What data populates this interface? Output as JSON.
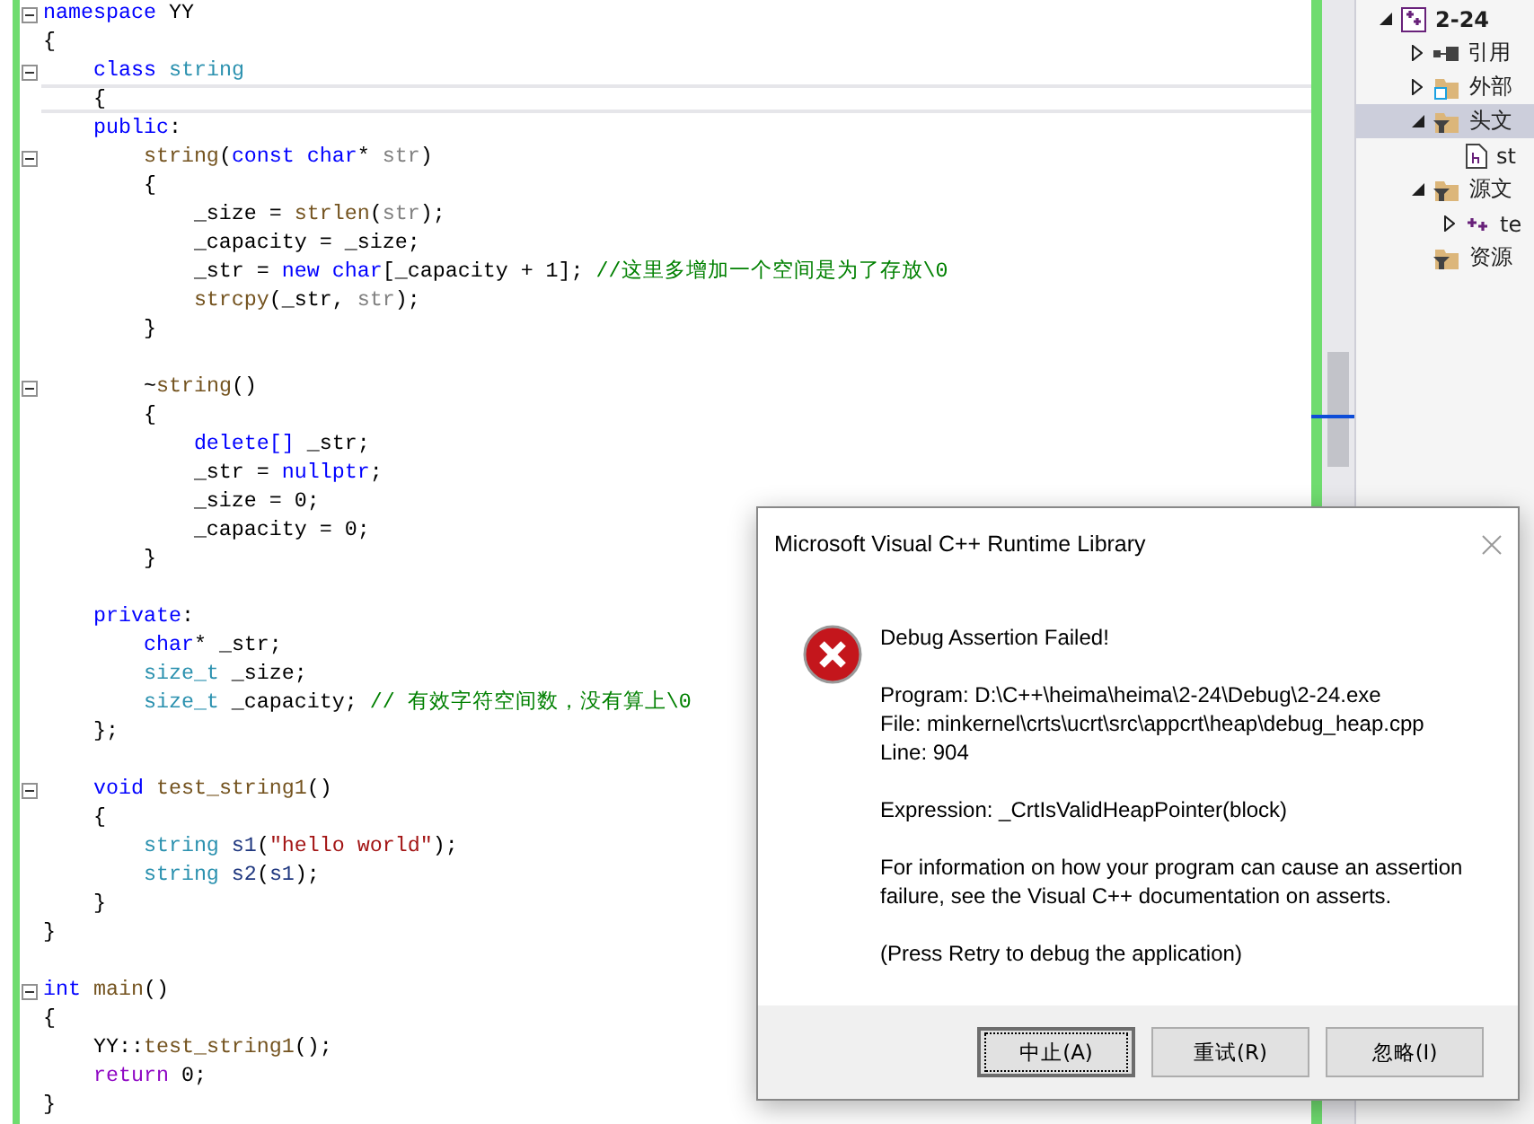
{
  "editor": {
    "lines": [
      {
        "fold": true,
        "current": false,
        "tokens": [
          {
            "kind": "kw",
            "text": "namespace"
          },
          {
            "kind": "plain",
            "text": " YY"
          }
        ]
      },
      {
        "fold": false,
        "current": false,
        "tokens": [
          {
            "kind": "plain",
            "text": "{"
          }
        ]
      },
      {
        "fold": true,
        "current": false,
        "tokens": [
          {
            "kind": "kw",
            "text": "    class"
          },
          {
            "kind": "type",
            "text": " string"
          }
        ]
      },
      {
        "fold": false,
        "current": true,
        "tokens": [
          {
            "kind": "plain",
            "text": "    {"
          }
        ]
      },
      {
        "fold": false,
        "current": false,
        "tokens": [
          {
            "kind": "kw",
            "text": "    public"
          },
          {
            "kind": "plain",
            "text": ":"
          }
        ]
      },
      {
        "fold": true,
        "current": false,
        "tokens": [
          {
            "kind": "fn",
            "text": "        string"
          },
          {
            "kind": "plain",
            "text": "("
          },
          {
            "kind": "kw",
            "text": "const char"
          },
          {
            "kind": "plain",
            "text": "* "
          },
          {
            "kind": "param",
            "text": "str"
          },
          {
            "kind": "plain",
            "text": ")"
          }
        ]
      },
      {
        "fold": false,
        "current": false,
        "tokens": [
          {
            "kind": "plain",
            "text": "        {"
          }
        ]
      },
      {
        "fold": false,
        "current": false,
        "tokens": [
          {
            "kind": "plain",
            "text": "            _size = "
          },
          {
            "kind": "fn",
            "text": "strlen"
          },
          {
            "kind": "plain",
            "text": "("
          },
          {
            "kind": "param",
            "text": "str"
          },
          {
            "kind": "plain",
            "text": ");"
          }
        ]
      },
      {
        "fold": false,
        "current": false,
        "tokens": [
          {
            "kind": "plain",
            "text": "            _capacity = _size;"
          }
        ]
      },
      {
        "fold": false,
        "current": false,
        "tokens": [
          {
            "kind": "plain",
            "text": "            _str = "
          },
          {
            "kind": "kw",
            "text": "new char"
          },
          {
            "kind": "plain",
            "text": "[_capacity + 1]; "
          },
          {
            "kind": "comment",
            "text": "//这里多增加一个空间是为了存放\\0"
          }
        ]
      },
      {
        "fold": false,
        "current": false,
        "tokens": [
          {
            "kind": "fn",
            "text": "            strcpy"
          },
          {
            "kind": "plain",
            "text": "(_str, "
          },
          {
            "kind": "param",
            "text": "str"
          },
          {
            "kind": "plain",
            "text": ");"
          }
        ]
      },
      {
        "fold": false,
        "current": false,
        "tokens": [
          {
            "kind": "plain",
            "text": "        }"
          }
        ]
      },
      {
        "fold": false,
        "current": false
      },
      {
        "fold": true,
        "current": false,
        "tokens": [
          {
            "kind": "plain",
            "text": "        ~"
          },
          {
            "kind": "fn",
            "text": "string"
          },
          {
            "kind": "plain",
            "text": "()"
          }
        ]
      },
      {
        "fold": false,
        "current": false,
        "tokens": [
          {
            "kind": "plain",
            "text": "        {"
          }
        ]
      },
      {
        "fold": false,
        "current": false,
        "tokens": [
          {
            "kind": "kw",
            "text": "            delete[]"
          },
          {
            "kind": "plain",
            "text": " _str;"
          }
        ]
      },
      {
        "fold": false,
        "current": false,
        "tokens": [
          {
            "kind": "plain",
            "text": "            _str = "
          },
          {
            "kind": "kw",
            "text": "nullptr"
          },
          {
            "kind": "plain",
            "text": ";"
          }
        ]
      },
      {
        "fold": false,
        "current": false,
        "tokens": [
          {
            "kind": "plain",
            "text": "            _size = 0;"
          }
        ]
      },
      {
        "fold": false,
        "current": false,
        "tokens": [
          {
            "kind": "plain",
            "text": "            _capacity = 0;"
          }
        ]
      },
      {
        "fold": false,
        "current": false,
        "tokens": [
          {
            "kind": "plain",
            "text": "        }"
          }
        ]
      },
      {
        "fold": false,
        "current": false
      },
      {
        "fold": false,
        "current": false,
        "tokens": [
          {
            "kind": "kw",
            "text": "    private"
          },
          {
            "kind": "plain",
            "text": ":"
          }
        ]
      },
      {
        "fold": false,
        "current": false,
        "tokens": [
          {
            "kind": "kw",
            "text": "        char"
          },
          {
            "kind": "plain",
            "text": "* _str;"
          }
        ]
      },
      {
        "fold": false,
        "current": false,
        "tokens": [
          {
            "kind": "type",
            "text": "        size_t"
          },
          {
            "kind": "plain",
            "text": " _size;"
          }
        ]
      },
      {
        "fold": false,
        "current": false,
        "tokens": [
          {
            "kind": "type",
            "text": "        size_t"
          },
          {
            "kind": "plain",
            "text": " _capacity; "
          },
          {
            "kind": "comment",
            "text": "// 有效字符空间数，没有算上\\0"
          }
        ]
      },
      {
        "fold": false,
        "current": false,
        "tokens": [
          {
            "kind": "plain",
            "text": "    };"
          }
        ]
      },
      {
        "fold": false,
        "current": false
      },
      {
        "fold": true,
        "current": false,
        "tokens": [
          {
            "kind": "kw",
            "text": "    void"
          },
          {
            "kind": "fn",
            "text": " test_string1"
          },
          {
            "kind": "plain",
            "text": "()"
          }
        ]
      },
      {
        "fold": false,
        "current": false,
        "tokens": [
          {
            "kind": "plain",
            "text": "    {"
          }
        ]
      },
      {
        "fold": false,
        "current": false,
        "tokens": [
          {
            "kind": "type",
            "text": "        string"
          },
          {
            "kind": "var",
            "text": " s1"
          },
          {
            "kind": "plain",
            "text": "("
          },
          {
            "kind": "str",
            "text": "\"hello world\""
          },
          {
            "kind": "plain",
            "text": ");"
          }
        ]
      },
      {
        "fold": false,
        "current": false,
        "tokens": [
          {
            "kind": "type",
            "text": "        string"
          },
          {
            "kind": "var",
            "text": " s2"
          },
          {
            "kind": "plain",
            "text": "("
          },
          {
            "kind": "var",
            "text": "s1"
          },
          {
            "kind": "plain",
            "text": ");"
          }
        ]
      },
      {
        "fold": false,
        "current": false,
        "tokens": [
          {
            "kind": "plain",
            "text": "    }"
          }
        ]
      },
      {
        "fold": false,
        "current": false,
        "tokens": [
          {
            "kind": "plain",
            "text": "}"
          }
        ]
      },
      {
        "fold": false,
        "current": false
      },
      {
        "fold": true,
        "current": false,
        "tokens": [
          {
            "kind": "kw",
            "text": "int"
          },
          {
            "kind": "fn",
            "text": " main"
          },
          {
            "kind": "plain",
            "text": "()"
          }
        ]
      },
      {
        "fold": false,
        "current": false,
        "tokens": [
          {
            "kind": "plain",
            "text": "{"
          }
        ]
      },
      {
        "fold": false,
        "current": false,
        "tokens": [
          {
            "kind": "plain",
            "text": "    YY::"
          },
          {
            "kind": "fn",
            "text": "test_string1"
          },
          {
            "kind": "plain",
            "text": "();"
          }
        ]
      },
      {
        "fold": false,
        "current": false,
        "tokens": [
          {
            "kind": "ctl",
            "text": "    return"
          },
          {
            "kind": "plain",
            "text": " 0;"
          }
        ]
      },
      {
        "fold": false,
        "current": false,
        "tokens": [
          {
            "kind": "plain",
            "text": "}"
          }
        ]
      }
    ]
  },
  "solution_explorer": {
    "items": [
      {
        "label": "2-24",
        "kind": "project",
        "expanded": true,
        "selected": false,
        "children": [
          {
            "label": "引用",
            "kind": "references",
            "expanded": false,
            "selected": false
          },
          {
            "label": "外部",
            "kind": "external",
            "expanded": false,
            "selected": false
          },
          {
            "label": "头文",
            "kind": "filter",
            "expanded": true,
            "selected": true,
            "children": [
              {
                "label": "st",
                "kind": "header"
              }
            ]
          },
          {
            "label": "源文",
            "kind": "filter",
            "expanded": true,
            "selected": false,
            "children": [
              {
                "label": "te",
                "kind": "source",
                "expanded": false,
                "selected": false
              }
            ]
          },
          {
            "label": "资源",
            "kind": "filter",
            "selected": false
          }
        ]
      }
    ]
  },
  "dialog": {
    "title": "Microsoft Visual C++ Runtime Library",
    "heading": "Debug Assertion Failed!",
    "details": [
      "Program: D:\\C++\\heima\\heima\\2-24\\Debug\\2-24.exe",
      "File: minkernel\\crts\\ucrt\\src\\appcrt\\heap\\debug_heap.cpp",
      "Line: 904"
    ],
    "expression": "Expression: _CrtIsValidHeapPointer(block)",
    "info": "For information on how your program can cause an assertion failure, see the Visual C++ documentation on asserts.",
    "hint": "(Press Retry to debug the application)",
    "buttons": [
      {
        "label": "中止(A)",
        "focused": true
      },
      {
        "label": "重试(R)",
        "focused": false
      },
      {
        "label": "忽略(I)",
        "focused": false
      }
    ]
  }
}
